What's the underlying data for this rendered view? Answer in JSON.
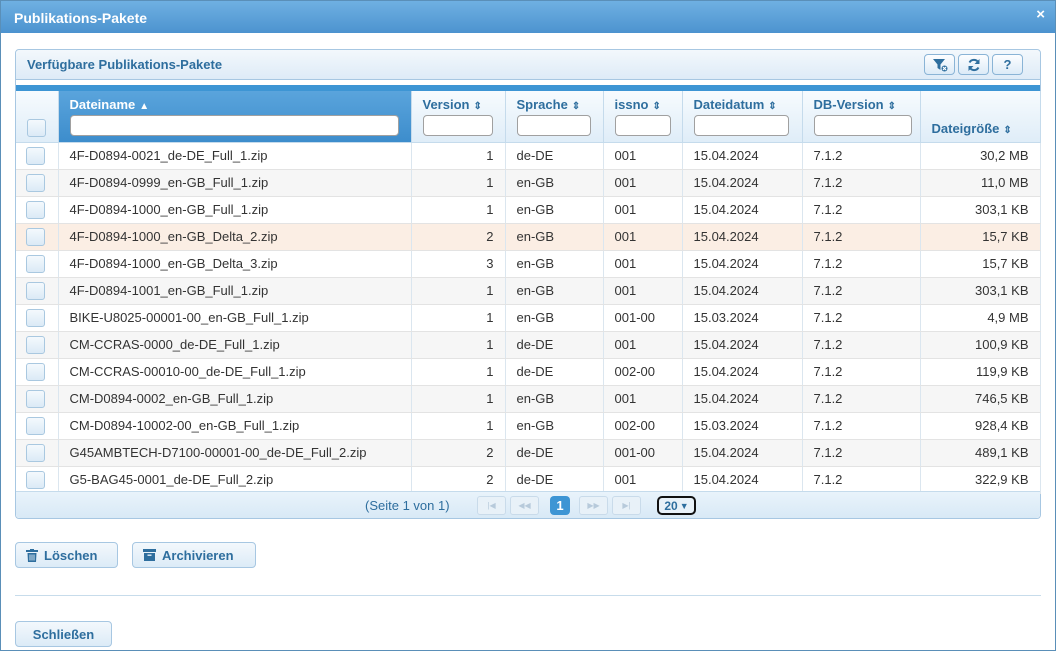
{
  "dialog": {
    "title": "Publikations-Pakete",
    "close_glyph": "×"
  },
  "panel": {
    "title": "Verfügbare Publikations-Pakete",
    "tools": [
      "filter-icon",
      "refresh-icon",
      "help-icon"
    ],
    "help_label": "?"
  },
  "columns": {
    "dateiname": "Dateiname",
    "version": "Version",
    "sprache": "Sprache",
    "issno": "issno",
    "dateidatum": "Dateidatum",
    "dbversion": "DB-Version",
    "dateigroesse": "Dateigröße"
  },
  "rows": [
    {
      "name": "4F-D0894-0021_de-DE_Full_1.zip",
      "version": "1",
      "sprache": "de-DE",
      "issno": "001",
      "datum": "15.04.2024",
      "db": "7.1.2",
      "size": "30,2 MB"
    },
    {
      "name": "4F-D0894-0999_en-GB_Full_1.zip",
      "version": "1",
      "sprache": "en-GB",
      "issno": "001",
      "datum": "15.04.2024",
      "db": "7.1.2",
      "size": "11,0 MB"
    },
    {
      "name": "4F-D0894-1000_en-GB_Full_1.zip",
      "version": "1",
      "sprache": "en-GB",
      "issno": "001",
      "datum": "15.04.2024",
      "db": "7.1.2",
      "size": "303,1 KB"
    },
    {
      "name": "4F-D0894-1000_en-GB_Delta_2.zip",
      "version": "2",
      "sprache": "en-GB",
      "issno": "001",
      "datum": "15.04.2024",
      "db": "7.1.2",
      "size": "15,7 KB"
    },
    {
      "name": "4F-D0894-1000_en-GB_Delta_3.zip",
      "version": "3",
      "sprache": "en-GB",
      "issno": "001",
      "datum": "15.04.2024",
      "db": "7.1.2",
      "size": "15,7 KB"
    },
    {
      "name": "4F-D0894-1001_en-GB_Full_1.zip",
      "version": "1",
      "sprache": "en-GB",
      "issno": "001",
      "datum": "15.04.2024",
      "db": "7.1.2",
      "size": "303,1 KB"
    },
    {
      "name": "BIKE-U8025-00001-00_en-GB_Full_1.zip",
      "version": "1",
      "sprache": "en-GB",
      "issno": "001-00",
      "datum": "15.03.2024",
      "db": "7.1.2",
      "size": "4,9 MB"
    },
    {
      "name": "CM-CCRAS-0000_de-DE_Full_1.zip",
      "version": "1",
      "sprache": "de-DE",
      "issno": "001",
      "datum": "15.04.2024",
      "db": "7.1.2",
      "size": "100,9 KB"
    },
    {
      "name": "CM-CCRAS-00010-00_de-DE_Full_1.zip",
      "version": "1",
      "sprache": "de-DE",
      "issno": "002-00",
      "datum": "15.04.2024",
      "db": "7.1.2",
      "size": "119,9 KB"
    },
    {
      "name": "CM-D0894-0002_en-GB_Full_1.zip",
      "version": "1",
      "sprache": "en-GB",
      "issno": "001",
      "datum": "15.04.2024",
      "db": "7.1.2",
      "size": "746,5 KB"
    },
    {
      "name": "CM-D0894-10002-00_en-GB_Full_1.zip",
      "version": "1",
      "sprache": "en-GB",
      "issno": "002-00",
      "datum": "15.03.2024",
      "db": "7.1.2",
      "size": "928,4 KB"
    },
    {
      "name": "G45AMBTECH-D7100-00001-00_de-DE_Full_2.zip",
      "version": "2",
      "sprache": "de-DE",
      "issno": "001-00",
      "datum": "15.04.2024",
      "db": "7.1.2",
      "size": "489,1 KB"
    },
    {
      "name": "G5-BAG45-0001_de-DE_Full_2.zip",
      "version": "2",
      "sprache": "de-DE",
      "issno": "001",
      "datum": "15.04.2024",
      "db": "7.1.2",
      "size": "322,9 KB"
    }
  ],
  "highlighted_row": 3,
  "pager": {
    "info": "(Seite 1 von 1)",
    "current_page": "1",
    "page_size": "20",
    "first": "|◀",
    "prev": "◀◀",
    "next": "▶▶",
    "last": "▶|"
  },
  "actions": {
    "delete_label": "Löschen",
    "archive_label": "Archivieren",
    "close_label": "Schließen"
  },
  "colors": {
    "accent": "#3d95d4",
    "header_text": "#2e6e9e",
    "highlight_row": "#fbeee4"
  }
}
